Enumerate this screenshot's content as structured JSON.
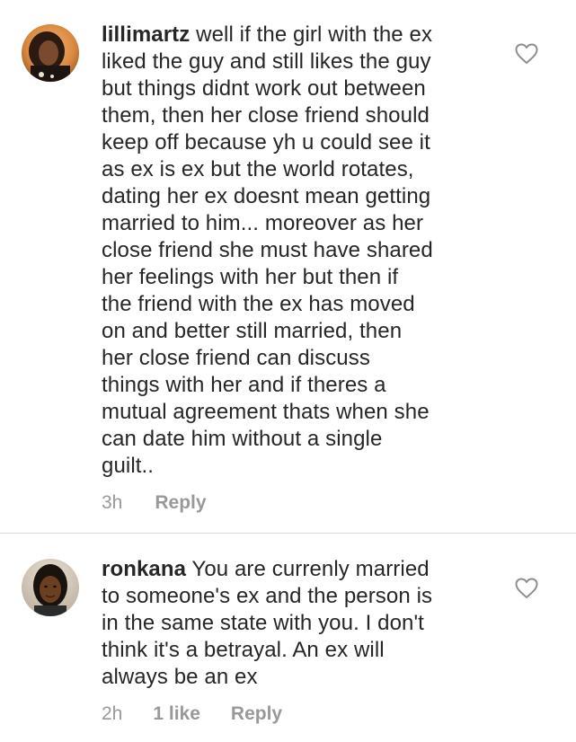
{
  "comments": [
    {
      "username": "lillimartz",
      "text": "well if the girl with the ex liked the guy and still likes the guy but things didnt work out between them, then her close friend should keep off because yh u could see it as ex is ex but the world rotates, dating her ex doesnt mean getting married to him... moreover as her close friend she must have shared her feelings with her but then if the friend with the ex has moved on and better still married, then her close friend can discuss things with her and if theres a mutual agreement thats when she can date him without a single guilt..",
      "lines": [
        "well if the girl with the ex",
        "liked the guy and still likes the guy",
        "but things didnt work out between",
        "them, then her close friend should",
        "keep off because yh u could see it",
        "as ex is ex but the world rotates,",
        "dating her ex doesnt mean getting",
        "married to him... moreover as her",
        "close friend she must have shared",
        "her feelings with her but then if",
        "the friend with the ex has moved",
        "on and better still married, then",
        "her close friend can discuss",
        "things with her and if theres a",
        "mutual agreement thats when she",
        "can date him without a single",
        "guilt.."
      ],
      "time": "3h",
      "likes": "",
      "reply_label": "Reply",
      "like_icon": "heart-outline-icon"
    },
    {
      "username": "ronkana",
      "text": "You are currenly married to someone's ex and the person is in the same state with you. I don't think it's a betrayal. An ex will always be an ex",
      "lines": [
        "You are currenly married",
        "to someone's ex and the person is",
        "in the same state with you. I don't",
        "think it's a betrayal. An ex will",
        "always be an ex"
      ],
      "time": "2h",
      "likes": "1 like",
      "reply_label": "Reply",
      "like_icon": "heart-outline-icon"
    }
  ],
  "colors": {
    "text": "#262626",
    "meta": "#999999",
    "divider": "#dbdbdb",
    "heart_stroke": "#8e8e8e"
  }
}
